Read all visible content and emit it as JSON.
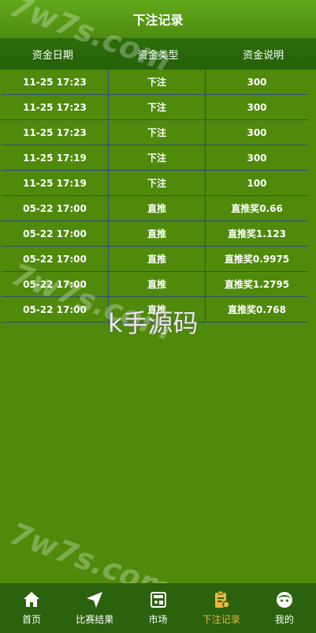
{
  "header": {
    "title": "下注记录"
  },
  "table": {
    "columns": [
      "资金日期",
      "资金类型",
      "资金说明"
    ],
    "rows": [
      [
        "11-25 17:23",
        "下注",
        "300"
      ],
      [
        "11-25 17:23",
        "下注",
        "300"
      ],
      [
        "11-25 17:23",
        "下注",
        "300"
      ],
      [
        "11-25 17:19",
        "下注",
        "300"
      ],
      [
        "11-25 17:19",
        "下注",
        "100"
      ],
      [
        "05-22 17:00",
        "直推",
        "直推奖0.66"
      ],
      [
        "05-22 17:00",
        "直推",
        "直推奖1.123"
      ],
      [
        "05-22 17:00",
        "直推",
        "直推奖0.9975"
      ],
      [
        "05-22 17:00",
        "直推",
        "直推奖1.2795"
      ],
      [
        "05-22 17:00",
        "直推",
        "直推奖0.768"
      ]
    ]
  },
  "watermarks": [
    "7w7s.com",
    "7w7s.com",
    "7w7s.com"
  ],
  "center_watermark": "k手源码",
  "footer": {
    "items": [
      {
        "label": "首页",
        "icon": "home-icon",
        "active": false
      },
      {
        "label": "比赛结果",
        "icon": "send-icon",
        "active": false
      },
      {
        "label": "市场",
        "icon": "market-icon",
        "active": false
      },
      {
        "label": "下注记录",
        "icon": "clipboard-icon",
        "active": true
      },
      {
        "label": "我的",
        "icon": "user-face-icon",
        "active": false
      }
    ]
  },
  "colors": {
    "background": "#4f8a0b",
    "active": "#f1b63a",
    "table_line": "#2d4a7c"
  }
}
